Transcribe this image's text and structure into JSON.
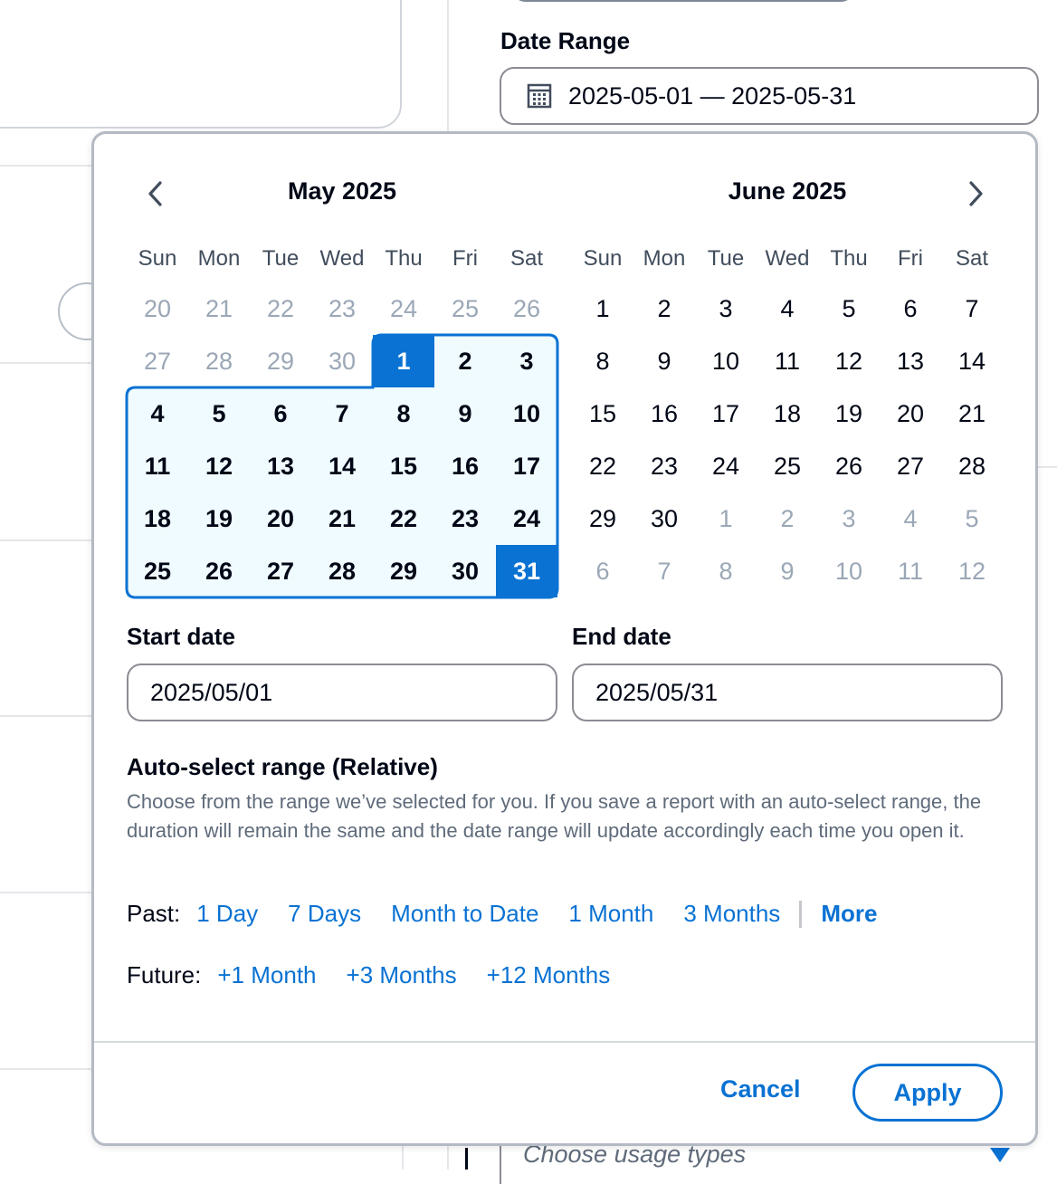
{
  "header": {
    "date_range_label": "Date Range",
    "date_range_value": "2025-05-01 — 2025-05-31"
  },
  "calendar": {
    "prev_icon": "chevron-left-icon",
    "next_icon": "chevron-right-icon",
    "weekdays": [
      "Sun",
      "Mon",
      "Tue",
      "Wed",
      "Thu",
      "Fri",
      "Sat"
    ],
    "months": [
      {
        "title": "May 2025",
        "weeks": [
          [
            "20",
            "21",
            "22",
            "23",
            "24",
            "25",
            "26"
          ],
          [
            "27",
            "28",
            "29",
            "30",
            "1",
            "2",
            "3"
          ],
          [
            "4",
            "5",
            "6",
            "7",
            "8",
            "9",
            "10"
          ],
          [
            "11",
            "12",
            "13",
            "14",
            "15",
            "16",
            "17"
          ],
          [
            "18",
            "19",
            "20",
            "21",
            "22",
            "23",
            "24"
          ],
          [
            "25",
            "26",
            "27",
            "28",
            "29",
            "30",
            "31"
          ]
        ]
      },
      {
        "title": "June 2025",
        "weeks": [
          [
            "1",
            "2",
            "3",
            "4",
            "5",
            "6",
            "7"
          ],
          [
            "8",
            "9",
            "10",
            "11",
            "12",
            "13",
            "14"
          ],
          [
            "15",
            "16",
            "17",
            "18",
            "19",
            "20",
            "21"
          ],
          [
            "22",
            "23",
            "24",
            "25",
            "26",
            "27",
            "28"
          ],
          [
            "29",
            "30",
            "1",
            "2",
            "3",
            "4",
            "5"
          ],
          [
            "6",
            "7",
            "8",
            "9",
            "10",
            "11",
            "12"
          ]
        ]
      }
    ]
  },
  "start_date": {
    "label": "Start date",
    "value": "2025/05/01"
  },
  "end_date": {
    "label": "End date",
    "value": "2025/05/31"
  },
  "auto_select": {
    "title": "Auto-select range (Relative)",
    "description": "Choose from the range we’ve selected for you. If you save a report with an auto-select range, the duration will remain the same and the date range will update accordingly each time you open it.",
    "past_label": "Past:",
    "past_options": [
      "1 Day",
      "7 Days",
      "Month to Date",
      "1 Month",
      "3 Months"
    ],
    "more_label": "More",
    "future_label": "Future:",
    "future_options": [
      "+1 Month",
      "+3 Months",
      "+12 Months"
    ]
  },
  "footer": {
    "cancel_label": "Cancel",
    "apply_label": "Apply"
  },
  "usage_types": {
    "placeholder": "Choose usage types",
    "icon": "caret-down-icon"
  },
  "colors": {
    "accent": "#0972d3",
    "range_fill": "#f0fbff",
    "muted_text": "#9ba7b6",
    "body_text": "#000716"
  }
}
